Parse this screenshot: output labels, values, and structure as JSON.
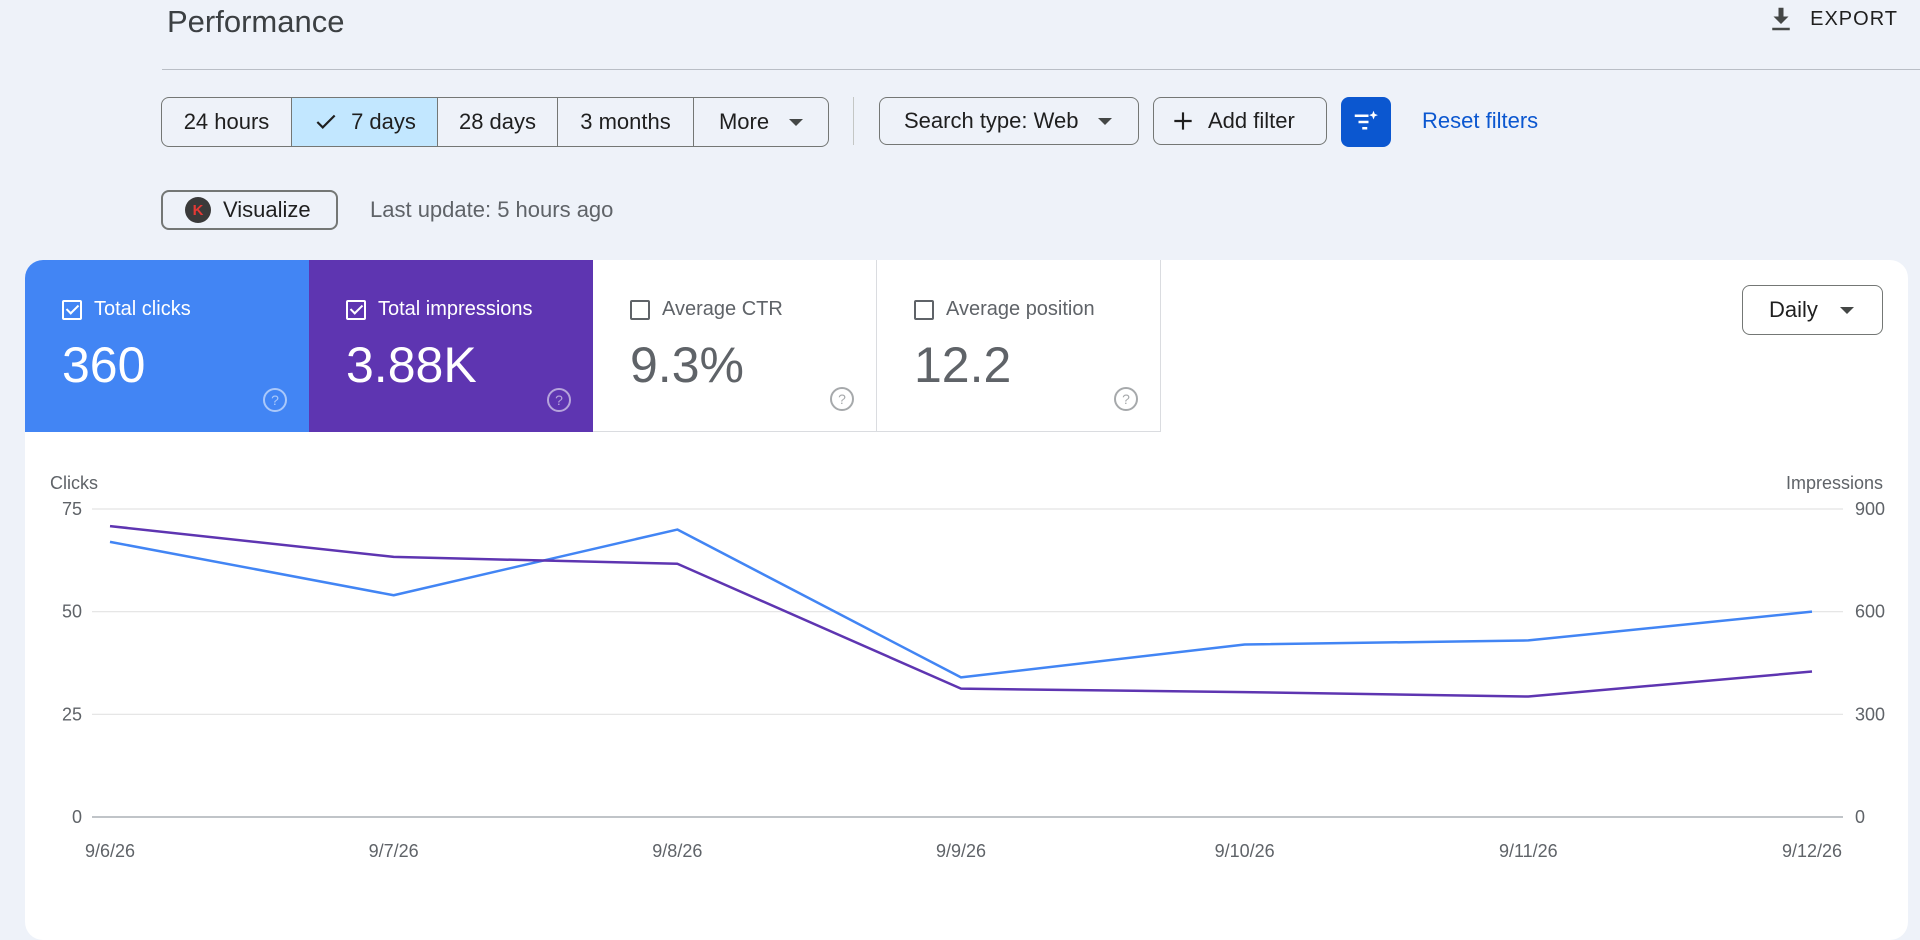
{
  "header": {
    "title": "Performance",
    "export_label": "EXPORT"
  },
  "date_range": {
    "options": [
      "24 hours",
      "7 days",
      "28 days",
      "3 months",
      "More"
    ],
    "selected": "7 days"
  },
  "filters": {
    "search_type": "Search type: Web",
    "add_filter": "Add filter",
    "reset": "Reset filters"
  },
  "visualize_label": "Visualize",
  "last_update": "Last update: 5 hours ago",
  "metrics": [
    {
      "label": "Total clicks",
      "value": "360",
      "checked": true,
      "color": "#4285f4"
    },
    {
      "label": "Total impressions",
      "value": "3.88K",
      "checked": true,
      "color": "#5e35b1"
    },
    {
      "label": "Average CTR",
      "value": "9.3%",
      "checked": false
    },
    {
      "label": "Average position",
      "value": "12.2",
      "checked": false
    }
  ],
  "granularity": "Daily",
  "chart_data": {
    "type": "line",
    "x": [
      "9/6/26",
      "9/7/26",
      "9/8/26",
      "9/9/26",
      "9/10/26",
      "9/11/26",
      "9/12/26"
    ],
    "left_axis": {
      "label": "Clicks",
      "ticks": [
        0,
        25,
        50,
        75
      ],
      "range": [
        0,
        75
      ]
    },
    "right_axis": {
      "label": "Impressions",
      "ticks": [
        0,
        300,
        600,
        900
      ],
      "range": [
        0,
        900
      ]
    },
    "series": [
      {
        "name": "Total clicks",
        "axis": "left",
        "color": "#4285f4",
        "values": [
          67,
          54,
          70,
          34,
          42,
          43,
          50
        ]
      },
      {
        "name": "Total impressions",
        "axis": "right",
        "color": "#5e35b1",
        "values": [
          850,
          760,
          740,
          375,
          365,
          352,
          425
        ]
      }
    ],
    "grid": true
  }
}
